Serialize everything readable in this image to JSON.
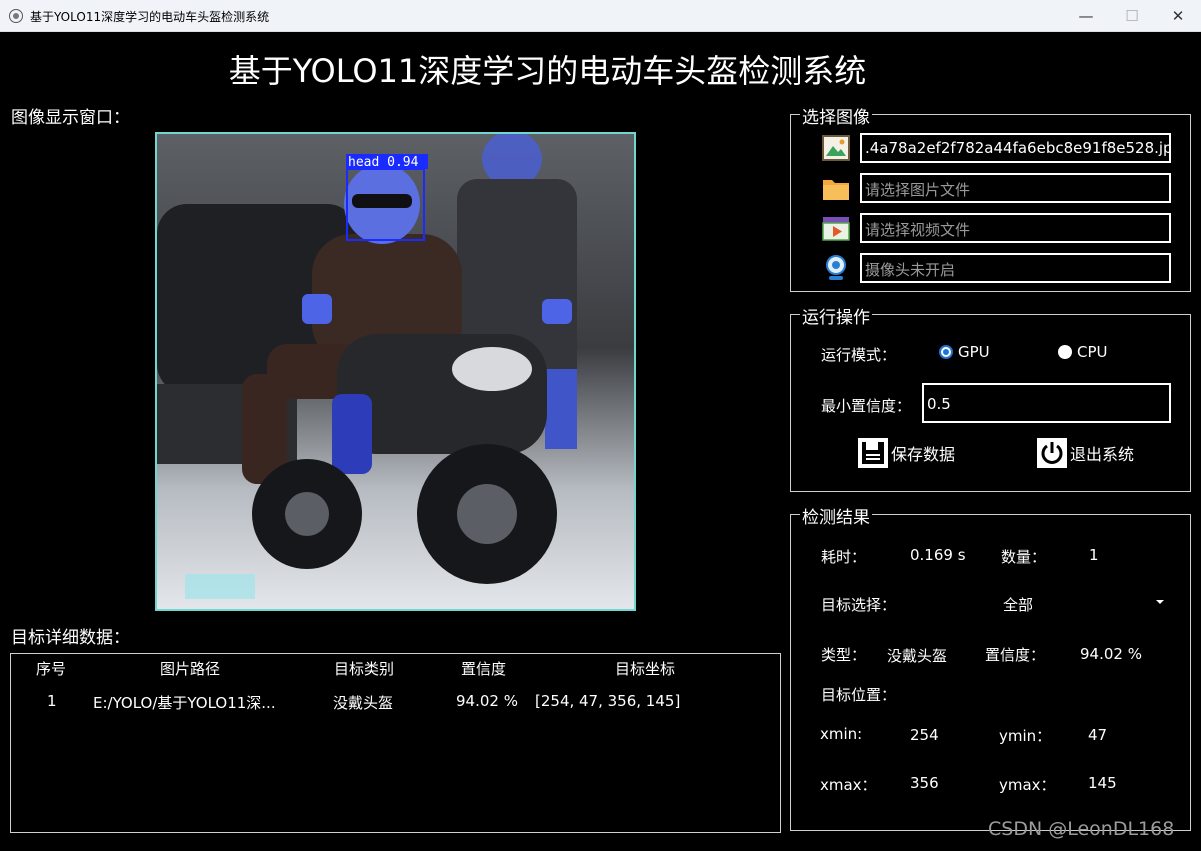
{
  "window": {
    "title": "基于YOLO11深度学习的电动车头盔检测系统",
    "min_glyph": "—",
    "max_glyph": "☐",
    "close_glyph": "✕"
  },
  "header": {
    "title": "基于YOLO11深度学习的电动车头盔检测系统"
  },
  "display": {
    "label": "图像显示窗口：",
    "detection_label": "head 0.94",
    "detection_color": "#1a2bff",
    "frame_color": "#6fd6d0"
  },
  "select_image": {
    "title": "选择图像",
    "image_path": ".4a78a2ef2f782a44fa6ebc8e91f8e528.jpg",
    "folder_placeholder": "请选择图片文件",
    "video_placeholder": "请选择视频文件",
    "camera_placeholder": "摄像头未开启",
    "icons": [
      "image-icon",
      "folder-icon",
      "video-icon",
      "camera-icon"
    ]
  },
  "operation": {
    "title": "运行操作",
    "mode_label": "运行模式：",
    "gpu_label": "GPU",
    "cpu_label": "CPU",
    "selected_mode": "GPU",
    "conf_label": "最小置信度：",
    "conf_value": "0.5",
    "save_label": "保存数据",
    "exit_label": "退出系统"
  },
  "results": {
    "title": "检测结果",
    "time_label": "耗时：",
    "time_value": "0.169 s",
    "count_label": "数量：",
    "count_value": "1",
    "target_select_label": "目标选择：",
    "target_select_value": "全部",
    "type_label": "类型：",
    "type_value": "没戴头盔",
    "conf_label": "置信度：",
    "conf_value": "94.02 %",
    "position_label": "目标位置：",
    "xmin_label": "xmin:",
    "xmin_value": "254",
    "ymin_label": "ymin：",
    "ymin_value": "47",
    "xmax_label": "xmax：",
    "xmax_value": "356",
    "ymax_label": "ymax：",
    "ymax_value": "145"
  },
  "details": {
    "label": "目标详细数据：",
    "columns": [
      "序号",
      "图片路径",
      "目标类别",
      "置信度",
      "目标坐标"
    ],
    "rows": [
      [
        "1",
        "E:/YOLO/基于YOLO11深...",
        "没戴头盔",
        "94.02 %",
        "[254, 47, 356, 145]"
      ]
    ]
  },
  "watermark": "CSDN @LeonDL168"
}
